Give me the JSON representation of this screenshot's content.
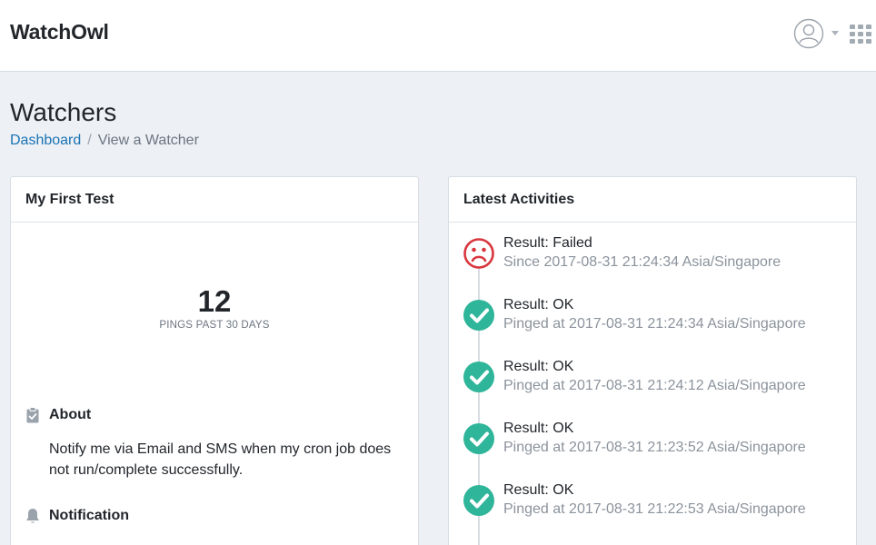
{
  "header": {
    "brand": "WatchOwl",
    "icons": {
      "account": "user-circle-icon",
      "dropdown": "caret-down-icon",
      "apps": "grid-icon"
    }
  },
  "page": {
    "title": "Watchers",
    "breadcrumb": [
      {
        "label": "Dashboard",
        "link": true
      },
      {
        "label": "View a Watcher",
        "link": false
      }
    ],
    "breadcrumb_separator": "/"
  },
  "watcher_card": {
    "title": "My First Test",
    "pings_count": "12",
    "pings_label": "PINGS PAST 30 DAYS",
    "about_heading": "About",
    "about_text": "Notify me via Email and SMS when my cron job does not run/complete successfully.",
    "notification_heading": "Notification"
  },
  "activities_card": {
    "title": "Latest Activities",
    "items": [
      {
        "status": "failed",
        "icon": "sad-face-icon",
        "result": "Result: Failed",
        "time": "Since 2017-08-31 21:24:34 Asia/Singapore"
      },
      {
        "status": "ok",
        "icon": "check-circle-icon",
        "result": "Result: OK",
        "time": "Pinged at 2017-08-31 21:24:34 Asia/Singapore"
      },
      {
        "status": "ok",
        "icon": "check-circle-icon",
        "result": "Result: OK",
        "time": "Pinged at 2017-08-31 21:24:12 Asia/Singapore"
      },
      {
        "status": "ok",
        "icon": "check-circle-icon",
        "result": "Result: OK",
        "time": "Pinged at 2017-08-31 21:23:52 Asia/Singapore"
      },
      {
        "status": "ok",
        "icon": "check-circle-icon",
        "result": "Result: OK",
        "time": "Pinged at 2017-08-31 21:22:53 Asia/Singapore"
      }
    ]
  },
  "colors": {
    "link": "#1a73b6",
    "ok": "#2fb59a",
    "failed": "#d9363e",
    "background": "#edf0f4"
  }
}
